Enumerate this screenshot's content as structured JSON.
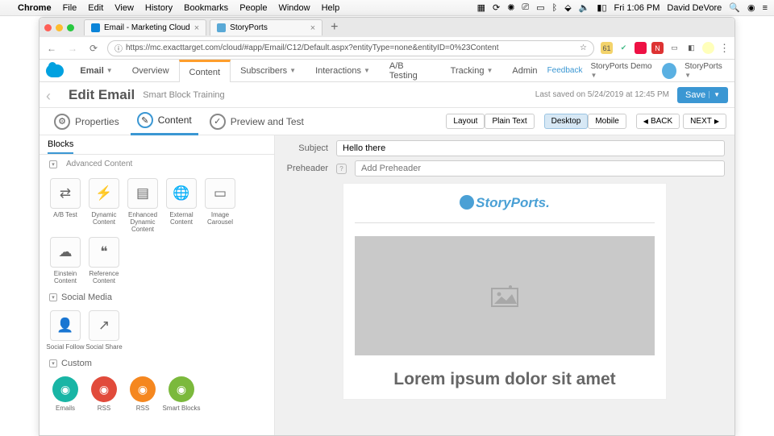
{
  "menubar": {
    "app": "Chrome",
    "items": [
      "File",
      "Edit",
      "View",
      "History",
      "Bookmarks",
      "People",
      "Window",
      "Help"
    ],
    "time": "Fri 1:06 PM",
    "user": "David DeVore"
  },
  "tabs": [
    {
      "title": "Email - Marketing Cloud"
    },
    {
      "title": "StoryPorts"
    }
  ],
  "url": "https://mc.exacttarget.com/cloud/#app/Email/C12/Default.aspx?entityType=none&entityID=0%23Content",
  "nav": {
    "app": "Email",
    "items": [
      "Overview",
      "Content",
      "Subscribers",
      "Interactions",
      "A/B Testing",
      "Tracking",
      "Admin"
    ],
    "feedback": "Feedback",
    "org": "StoryPorts Demo",
    "user": "StoryPorts"
  },
  "header": {
    "title": "Edit Email",
    "sub": "Smart Block Training",
    "saved": "Last saved on 5/24/2019 at 12:45 PM",
    "save": "Save"
  },
  "steps": {
    "p": "Properties",
    "c": "Content",
    "pt": "Preview and Test",
    "back": "BACK",
    "next": "NEXT",
    "layout": "Layout",
    "plain": "Plain Text",
    "desktop": "Desktop",
    "mobile": "Mobile"
  },
  "side": {
    "tab": "Blocks",
    "cut": "Advanced Content",
    "adv": [
      {
        "l": "A/B Test",
        "g": "⇄"
      },
      {
        "l": "Dynamic Content",
        "g": "⚡"
      },
      {
        "l": "Enhanced Dynamic Content",
        "g": "▤"
      },
      {
        "l": "External Content",
        "g": "🌐"
      },
      {
        "l": "Image Carousel",
        "g": "▭"
      },
      {
        "l": "Einstein Content",
        "g": "☁"
      },
      {
        "l": "Reference Content",
        "g": "❝"
      }
    ],
    "social_h": "Social Media",
    "social": [
      {
        "l": "Social Follow",
        "g": "👤"
      },
      {
        "l": "Social Share",
        "g": "↗"
      }
    ],
    "cust_h": "Custom",
    "cust": [
      {
        "l": "Emails",
        "c": "#19b5a5"
      },
      {
        "l": "RSS",
        "c": "#e14b3b"
      },
      {
        "l": "RSS",
        "c": "#f5871f"
      },
      {
        "l": "Smart Blocks",
        "c": "#7bb93c"
      }
    ]
  },
  "canvas": {
    "subject_l": "Subject",
    "subject": "Hello there",
    "pre_l": "Preheader",
    "pre_ph": "Add Preheader",
    "brand": "StoryPorts.",
    "lorem": "Lorem ipsum dolor sit amet"
  }
}
